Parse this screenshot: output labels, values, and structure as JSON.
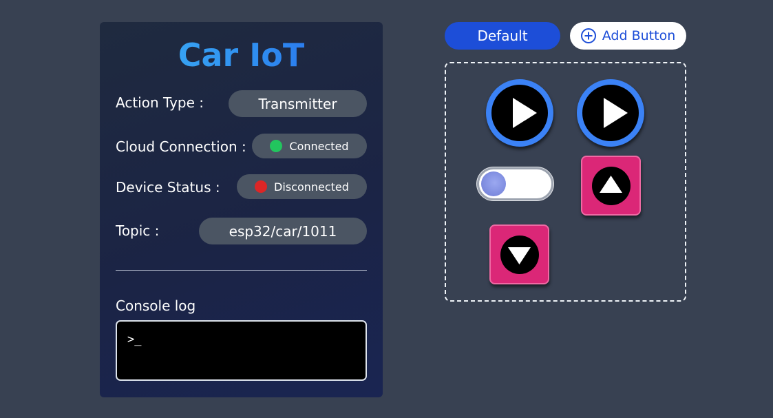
{
  "panel": {
    "title": "Car IoT",
    "rows": [
      {
        "label": "Action Type :",
        "value": "Transmitter"
      },
      {
        "label": "Cloud Connection :",
        "value": "Connected",
        "status_color": "#22c55e"
      },
      {
        "label": "Device Status :",
        "value": "Disconnected",
        "status_color": "#dc2626"
      },
      {
        "label": "Topic :",
        "value": "esp32/car/1011"
      }
    ],
    "console": {
      "label": "Console log",
      "content": ">_"
    }
  },
  "toolbar": {
    "default_label": "Default",
    "add_button_label": "Add Button"
  },
  "controls": [
    {
      "type": "play-button",
      "icon": "play-icon"
    },
    {
      "type": "play-button",
      "icon": "play-icon"
    },
    {
      "type": "toggle-switch",
      "state": "off"
    },
    {
      "type": "push-button",
      "icon": "triangle-up-icon"
    },
    {
      "type": "push-button",
      "icon": "triangle-down-icon"
    }
  ],
  "colors": {
    "background": "#384152",
    "accent_blue": "#1d4ed8",
    "play_ring": "#3b82f6",
    "push_button": "#db2777",
    "connected": "#22c55e",
    "disconnected": "#dc2626"
  }
}
